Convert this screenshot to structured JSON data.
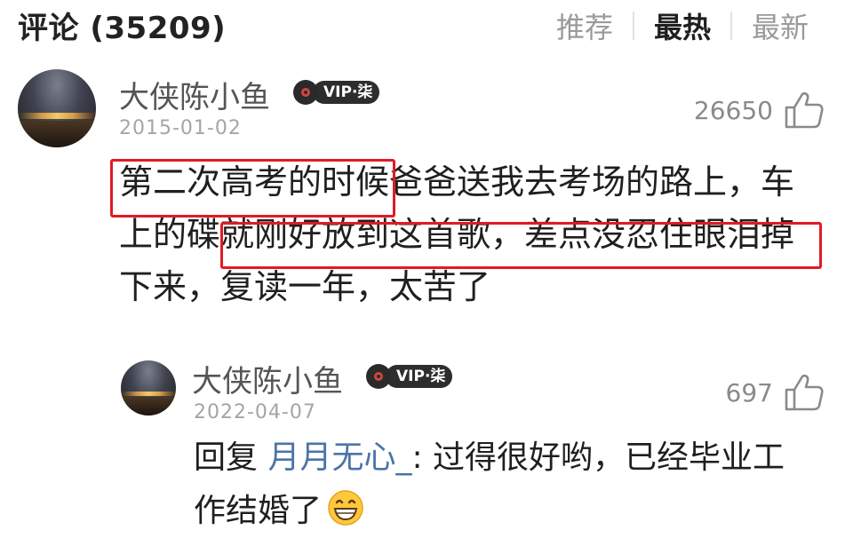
{
  "header": {
    "title": "评论 (35209)",
    "sort_tabs": [
      "推荐",
      "最热",
      "最新"
    ],
    "active_tab": "最热"
  },
  "comment": {
    "user_name": "大侠陈小鱼",
    "vip_label": "VIP·柒",
    "date": "2015-01-02",
    "like_count": "26650",
    "lines": [
      [
        "第二次高考的时候",
        "爸爸送我去考场的路上，车"
      ],
      [
        "上的碟",
        "就刚好放到这首歌，差点没忍住眼泪掉"
      ],
      [
        "下来，复读一年，太苦了"
      ]
    ],
    "highlight_color": "#e01b24"
  },
  "reply": {
    "user_name": "大侠陈小鱼",
    "vip_label": "VIP·柒",
    "date": "2022-04-07",
    "like_count": "697",
    "prefix": "回复",
    "mention": "月月无心_",
    "text_line1": ": 过得很好哟，已经毕业工",
    "text_line2": "作结婚了",
    "emoji": "grinning-face"
  },
  "icons": {
    "like": "thumbs-up-outline-icon",
    "vip_disc": "vinyl-record-icon"
  }
}
